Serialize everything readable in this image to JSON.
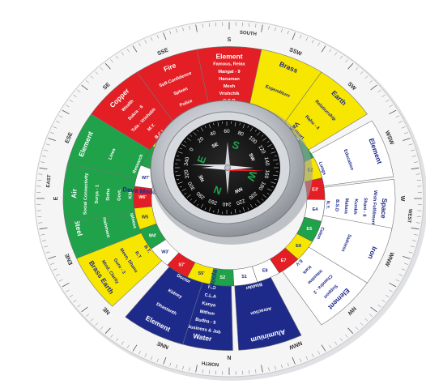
{
  "colors": {
    "red": "#e31e24",
    "yellow": "#f7e600",
    "green": "#1fa24a",
    "blue": "#1d2a8a",
    "white": "#ffffff",
    "ring": "#f4f4f4",
    "steel": "#c9ccd1"
  },
  "scale_ring": {
    "directions": [
      "N",
      "NNE",
      "NE",
      "ENE",
      "E",
      "ESE",
      "SE",
      "SSE",
      "S",
      "SSW",
      "SW",
      "WSW",
      "W",
      "WNW",
      "NW",
      "NNW"
    ],
    "north_word": "NORTH",
    "south_word": "SOUTH",
    "east_word": "EAST",
    "west_word": "WEST"
  },
  "sectors": [
    {
      "id": "ese",
      "color": "green",
      "lines": [
        "Element",
        "Lines",
        "Research"
      ]
    },
    {
      "id": "se",
      "color": "red",
      "lines": [
        "Copper",
        "Wealth",
        "Sukra - 6",
        "Tula - Vrishabh",
        "M.Y.",
        "B.C.I"
      ]
    },
    {
      "id": "sse",
      "color": "red",
      "lines": [
        "Fire",
        "Self-Confidence",
        "Spleen",
        "Police",
        "Army"
      ]
    },
    {
      "id": "s",
      "color": "red",
      "lines": [
        "Element",
        "Famous, Relax",
        "Mangal - 9",
        "Hanuman",
        "Mesh",
        "Vrishchik",
        "G.S.D",
        "T.P.S"
      ]
    },
    {
      "id": "ssw",
      "color": "yellow",
      "lines": [
        "Brass",
        "Expenditure",
        "Stomach"
      ]
    },
    {
      "id": "sw",
      "color": "yellow",
      "lines": [
        "Earth",
        "Relationship",
        "Rahu - 4",
        "Heart"
      ]
    },
    {
      "id": "w",
      "color": "white",
      "lines": [
        "Element",
        "Education",
        "Lungs"
      ]
    },
    {
      "id": "wnw",
      "color": "white",
      "lines": [
        "Space",
        "Wish Fulfillment",
        "Shani - 8",
        "Kumbh",
        "Makara",
        "B.S.D",
        "N.Y."
      ]
    },
    {
      "id": "nw",
      "color": "white",
      "lines": [
        "Iron",
        "Sadness",
        "Colon"
      ]
    },
    {
      "id": "nnw",
      "color": "white",
      "lines": [
        "Element",
        "Support",
        "Chandra - 2",
        "Intestine",
        "Kark",
        "E.V"
      ]
    },
    {
      "id": "n",
      "color": "blue",
      "lines": [
        "Aluminium",
        "Attraction",
        "Bladder"
      ]
    },
    {
      "id": "nne",
      "color": "blue",
      "lines": [
        "Water",
        "Business & Job",
        "Budha - 5",
        "Mithun",
        "Kanya",
        "C.L.A",
        "H.D"
      ]
    },
    {
      "id": "ne",
      "color": "blue",
      "lines": [
        "Element",
        "Dhastanth",
        "Kidney",
        "Doctor"
      ]
    },
    {
      "id": "ene",
      "color": "yellow",
      "lines": [
        "Brass Earth",
        "Mind, Clarity",
        "Guru - 3",
        "Meen, Dhanu",
        "R.T",
        "B.T."
      ]
    },
    {
      "id": "e",
      "color": "green",
      "lines": [
        "Steel",
        "Entertainment",
        "Happiness"
      ]
    },
    {
      "id": "ene2",
      "color": "green",
      "lines": [
        "Air",
        "Social Connectivity",
        "Surya - 1",
        "Sinha",
        "Govt.",
        "Kill"
      ]
    }
  ],
  "inner_ring": {
    "deva_moola": "Deva Moola",
    "vayu_moola": "Vayu Moola",
    "moola": "Moola",
    "codes": [
      "S1",
      "S2",
      "S5'",
      "S7'",
      "W3'",
      "W4'",
      "W5",
      "W6'",
      "W7'",
      "N1",
      "N2",
      "N3",
      "N4'",
      "N5",
      "N6",
      "N7",
      "N8",
      "E1",
      "E2",
      "E3'",
      "E4",
      "E5",
      "E6",
      "E7",
      "E8"
    ]
  },
  "compass": {
    "dial_numbers": [
      "0",
      "20",
      "40",
      "60",
      "80",
      "100",
      "120",
      "140",
      "160",
      "180",
      "200",
      "220",
      "240",
      "260",
      "280",
      "300",
      "320",
      "340"
    ],
    "cardinals": [
      "N",
      "E",
      "S",
      "W"
    ],
    "intercardinals": [
      "NE",
      "SE",
      "SW",
      "NW"
    ]
  }
}
